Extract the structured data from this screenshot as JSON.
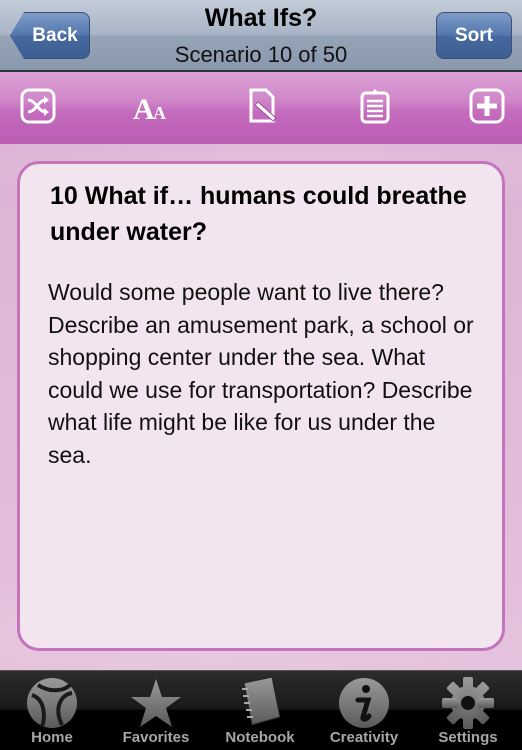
{
  "navbar": {
    "title": "What Ifs?",
    "subtitle": "Scenario 10 of 50",
    "back_label": "Back",
    "sort_label": "Sort"
  },
  "toolbar": {
    "items": [
      {
        "name": "shuffle",
        "icon": "shuffle-icon"
      },
      {
        "name": "font-size",
        "icon": "font-size-icon"
      },
      {
        "name": "edit-note",
        "icon": "edit-document-icon"
      },
      {
        "name": "clipboard",
        "icon": "clipboard-icon"
      },
      {
        "name": "add",
        "icon": "plus-icon"
      }
    ]
  },
  "card": {
    "title": "10 What if…  humans could breathe under water?",
    "body": "Would some people want to live there? Describe an amusement park, a school or shopping center under the sea. What could we use for transportation? Describe what life might be like for us under the sea."
  },
  "tabbar": {
    "items": [
      {
        "label": "Home",
        "icon": "home-swirl-icon"
      },
      {
        "label": "Favorites",
        "icon": "star-icon"
      },
      {
        "label": "Notebook",
        "icon": "notebook-icon"
      },
      {
        "label": "Creativity",
        "icon": "info-icon"
      },
      {
        "label": "Settings",
        "icon": "gear-icon"
      }
    ]
  },
  "colors": {
    "nav_button": "#4a6ea4",
    "toolbar": "#c46cbe",
    "card_border": "#c275bc",
    "card_bg": "#f3e5ef",
    "tab_label": "#a6a6a6"
  }
}
